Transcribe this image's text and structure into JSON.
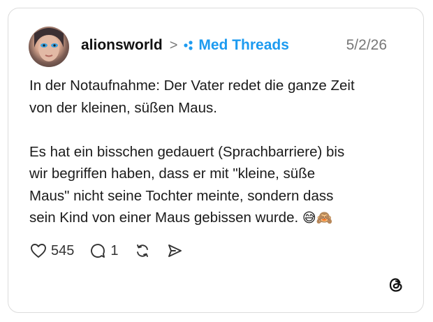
{
  "post": {
    "username": "alionsworld",
    "community": "Med Threads",
    "date": "5/2/26",
    "text_lines": [
      "In der Notaufnahme: Der Vater redet die ganze Zeit",
      "von der kleinen, süßen Maus.",
      "Es hat ein bisschen gedauert (Sprachbarriere) bis",
      "wir begriffen haben, dass er mit \"kleine, süße",
      "Maus\" nicht seine Tochter meinte, sondern dass",
      "sein Kind von einer Maus gebissen wurde."
    ],
    "emojis": "😅🙈"
  },
  "actions": {
    "likes": "545",
    "replies": "1"
  },
  "icons": {
    "like": "heart-icon",
    "reply": "comment-icon",
    "repost": "repost-icon",
    "share": "send-icon",
    "community": "community-icon",
    "brand": "threads-logo-icon"
  },
  "colors": {
    "community": "#1d9bf0",
    "date": "#777777",
    "border": "#dcdcdc"
  }
}
